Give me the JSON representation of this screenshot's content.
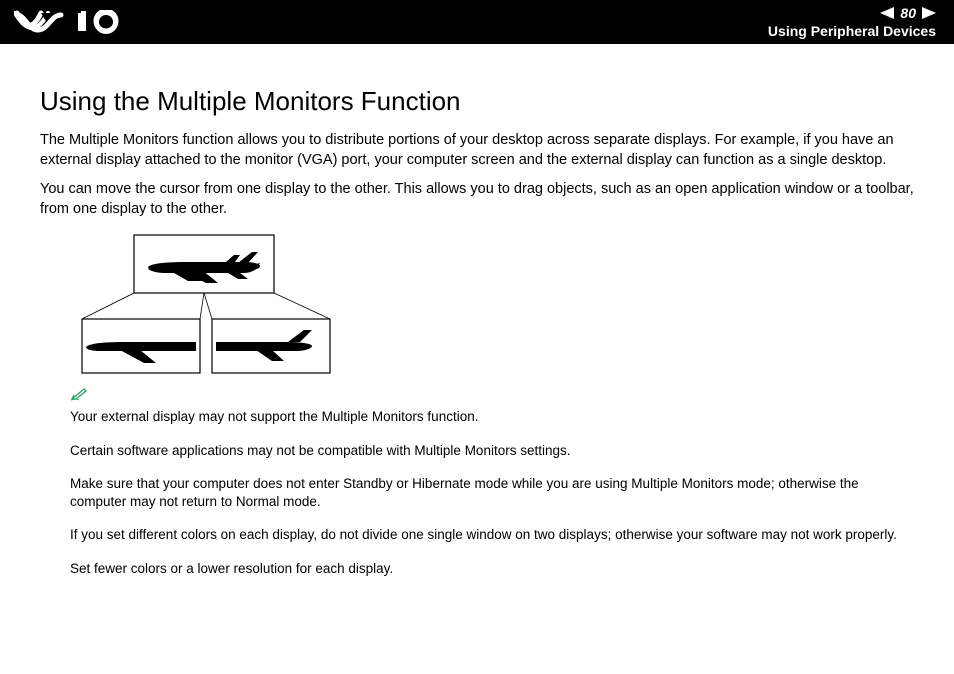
{
  "header": {
    "page_number": "80",
    "section": "Using Peripheral Devices"
  },
  "title": "Using the Multiple Monitors Function",
  "paragraphs": [
    "The Multiple Monitors function allows you to distribute portions of your desktop across separate displays. For example, if you have an external display attached to the monitor (VGA) port, your computer screen and the external display can function as a single desktop.",
    "You can move the cursor from one display to the other. This allows you to drag objects, such as an open application window or a toolbar, from one display to the other."
  ],
  "notes": [
    "Your external display may not support the Multiple Monitors function.",
    "Certain software applications may not be compatible with Multiple Monitors settings.",
    "Make sure that your computer does not enter Standby or Hibernate mode while you are using Multiple Monitors mode; otherwise the computer may not return to Normal mode.",
    "If you set different colors on each display, do not divide one single window on two displays; otherwise your software may not work properly.",
    "Set fewer colors or a lower resolution for each display."
  ]
}
